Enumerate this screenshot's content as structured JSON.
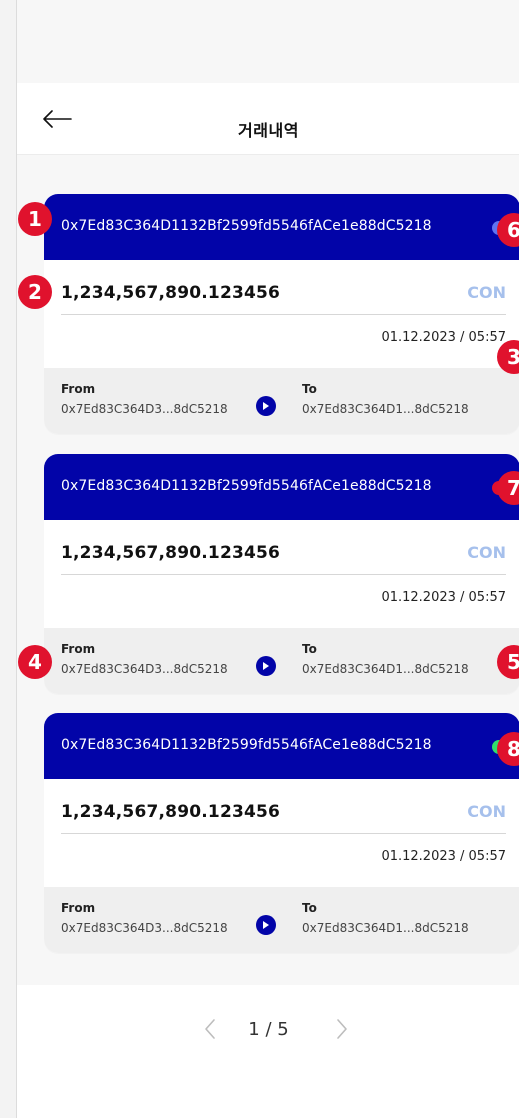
{
  "header": {
    "title": "거래내역"
  },
  "colors": {
    "card_header": "#0204a8",
    "token_text": "#a6c0ec",
    "marker": "#e0122d",
    "status_blue": "#5f73f2",
    "status_red": "#e00f2e",
    "status_green": "#31df6b"
  },
  "cards": [
    {
      "address": "0x7Ed83C364D1132Bf2599fd5546fACe1e88dC5218",
      "status": "status-blue-dot",
      "amount": "1,234,567,890.123456",
      "token": "CON",
      "datetime": "01.12.2023 / 05:57",
      "from_label": "From",
      "from_value": "0x7Ed83C364D3...8dC5218",
      "to_label": "To",
      "to_value": "0x7Ed83C364D1...8dC5218"
    },
    {
      "address": "0x7Ed83C364D1132Bf2599fd5546fACe1e88dC5218",
      "status": "status-red-dot",
      "amount": "1,234,567,890.123456",
      "token": "CON",
      "datetime": "01.12.2023 / 05:57",
      "from_label": "From",
      "from_value": "0x7Ed83C364D3...8dC5218",
      "to_label": "To",
      "to_value": "0x7Ed83C364D1...8dC5218"
    },
    {
      "address": "0x7Ed83C364D1132Bf2599fd5546fACe1e88dC5218",
      "status": "status-green-dot",
      "amount": "1,234,567,890.123456",
      "token": "CON",
      "datetime": "01.12.2023 / 05:57",
      "from_label": "From",
      "from_value": "0x7Ed83C364D3...8dC5218",
      "to_label": "To",
      "to_value": "0x7Ed83C364D1...8dC5218"
    }
  ],
  "pagination": {
    "page_text": "1 / 5",
    "prev_icon": "chevron-left-icon",
    "next_icon": "chevron-right-icon"
  },
  "markers": [
    "1",
    "2",
    "3",
    "4",
    "5",
    "6",
    "7",
    "8"
  ]
}
